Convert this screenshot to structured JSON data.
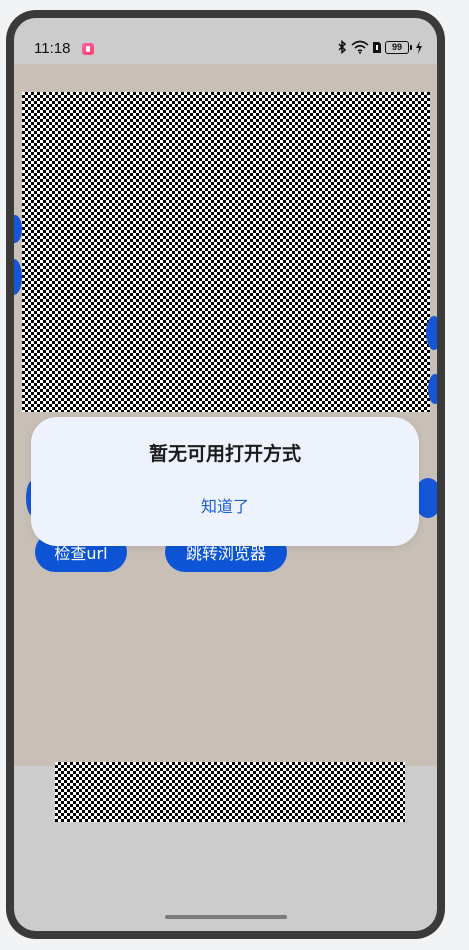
{
  "status_bar": {
    "time": "11:18",
    "battery_level": "99",
    "icons": [
      "app-notification-icon",
      "bluetooth-icon",
      "wifi-icon",
      "sim-icon",
      "battery-icon",
      "charging-icon"
    ]
  },
  "page": {
    "buttons": {
      "check_url": "检查url",
      "jump_browser": "跳转浏览器"
    }
  },
  "dialog": {
    "title": "暂无可用打开方式",
    "ok_label": "知道了"
  },
  "colors": {
    "primary": "#0d55d6",
    "dialog_bg": "#eef2fc",
    "content_bg": "#c8bfb6",
    "link": "#1a5fd0"
  }
}
